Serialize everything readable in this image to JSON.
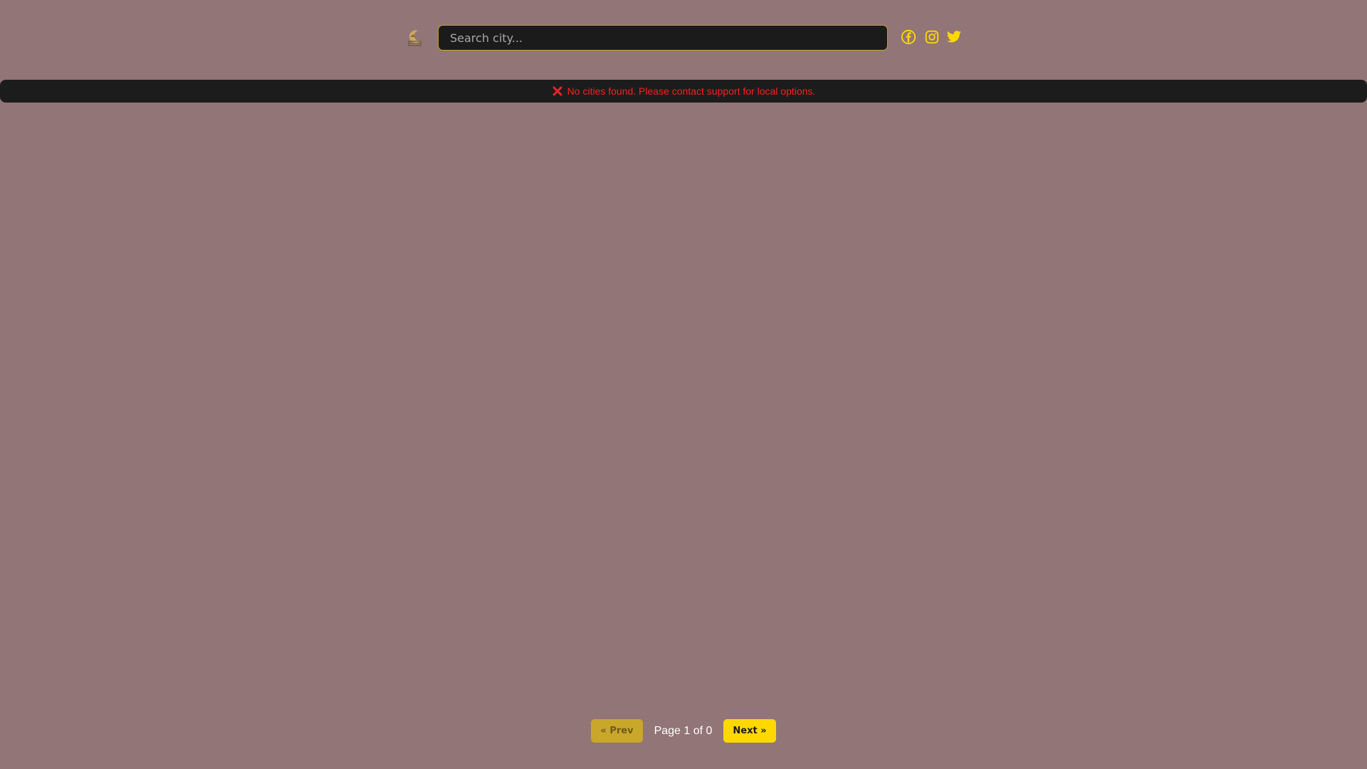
{
  "header": {
    "logo_icon": "moon-house-logo-icon",
    "search": {
      "placeholder": "Search city...",
      "value": ""
    },
    "social_icons": [
      "facebook-icon",
      "instagram-icon",
      "twitter-icon"
    ]
  },
  "banner": {
    "icon": "cross-mark-icon",
    "message": "No cities found. Please contact support for local options."
  },
  "pagination": {
    "prev_label": "« Prev",
    "page_info": "Page 1 of 0",
    "next_label": "Next »"
  },
  "colors": {
    "background": "#927576",
    "accent": "#ffd800",
    "error": "#ff1e1e",
    "bar": "#1c1c1c"
  }
}
